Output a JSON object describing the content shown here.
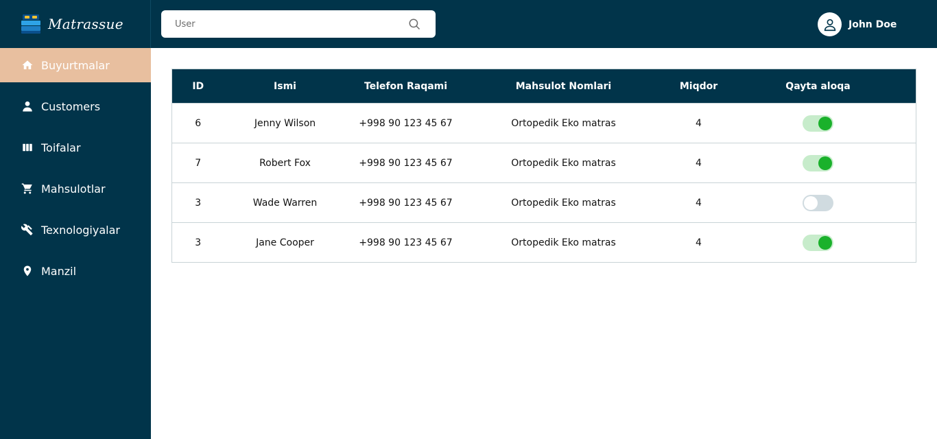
{
  "brand": {
    "name": "Matrassue",
    "logo_icon": "bed-logo-icon"
  },
  "search": {
    "placeholder": "User",
    "icon": "search-icon"
  },
  "user": {
    "name": "John Doe",
    "icon": "user-avatar-icon"
  },
  "sidebar": {
    "items": [
      {
        "label": "Buyurtmalar",
        "icon": "home-icon",
        "active": true
      },
      {
        "label": "Customers",
        "icon": "person-icon",
        "active": false
      },
      {
        "label": "Toifalar",
        "icon": "columns-icon",
        "active": false
      },
      {
        "label": "Mahsulotlar",
        "icon": "cart-icon",
        "active": false
      },
      {
        "label": "Texnologiyalar",
        "icon": "tools-icon",
        "active": false
      },
      {
        "label": "Manzil",
        "icon": "location-pin-icon",
        "active": false
      }
    ]
  },
  "table": {
    "headers": [
      "ID",
      "Ismi",
      "Telefon Raqami",
      "Mahsulot Nomlari",
      "Miqdor",
      "Qayta aloqa"
    ],
    "rows": [
      {
        "id": "6",
        "name": "Jenny Wilson",
        "phone": "+998 90 123 45 67",
        "product": "Ortopedik Eko matras",
        "qty": "4",
        "callback": true
      },
      {
        "id": "7",
        "name": "Robert Fox",
        "phone": "+998 90 123 45 67",
        "product": "Ortopedik Eko matras",
        "qty": "4",
        "callback": true
      },
      {
        "id": "3",
        "name": "Wade Warren",
        "phone": "+998 90 123 45 67",
        "product": "Ortopedik Eko matras",
        "qty": "4",
        "callback": false
      },
      {
        "id": "3",
        "name": "Jane Cooper",
        "phone": "+998 90 123 45 67",
        "product": "Ortopedik Eko matras",
        "qty": "4",
        "callback": true
      }
    ]
  },
  "colors": {
    "primary": "#01344a",
    "active_nav": "#e8bf9f",
    "toggle_on": "#1ab12b",
    "toggle_on_track": "#c7eccb",
    "toggle_off_track": "#d0dbe0"
  }
}
